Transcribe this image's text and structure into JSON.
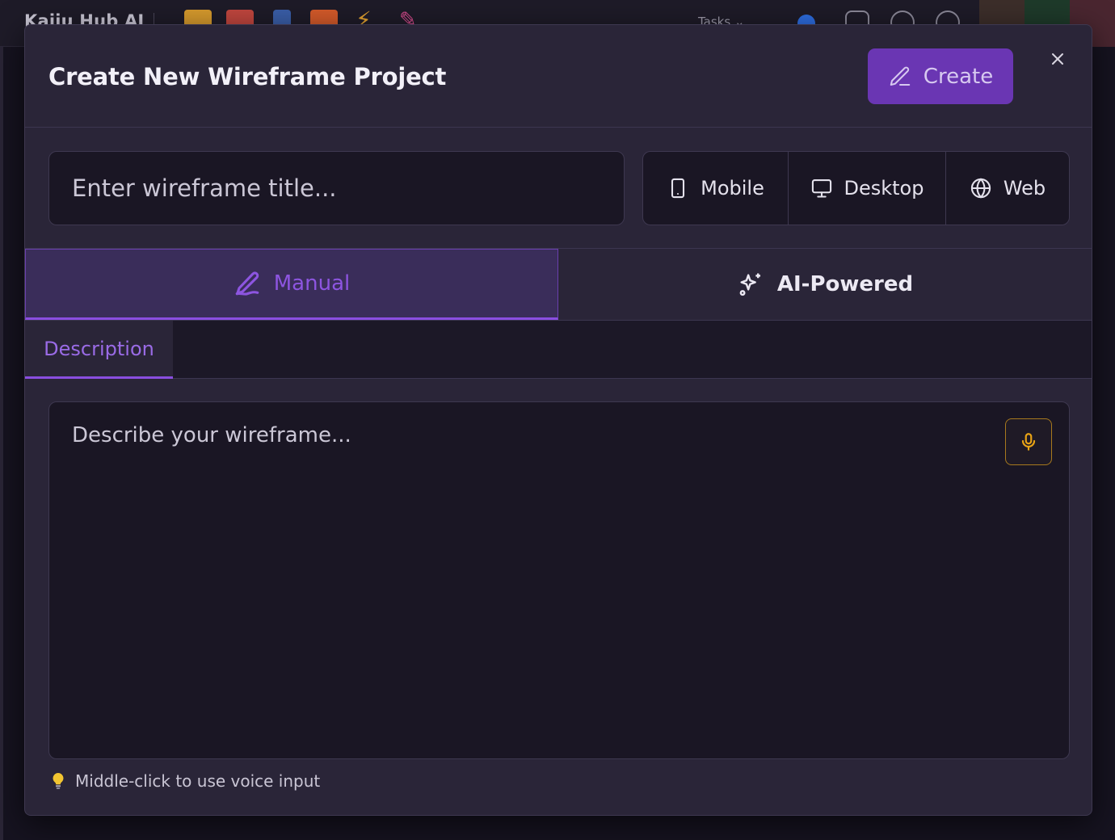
{
  "background_app": {
    "title": "Kaiju Hub AI",
    "tasks_label": "Tasks"
  },
  "modal": {
    "title": "Create New Wireframe Project",
    "create_label": "Create",
    "title_placeholder": "Enter wireframe title...",
    "devices": [
      {
        "label": "Mobile",
        "icon": "mobile-icon"
      },
      {
        "label": "Desktop",
        "icon": "desktop-icon"
      },
      {
        "label": "Web",
        "icon": "globe-icon"
      }
    ],
    "mode_tabs": [
      {
        "label": "Manual",
        "icon": "pen-icon",
        "active": true
      },
      {
        "label": "AI-Powered",
        "icon": "sparkles-icon",
        "active": false
      }
    ],
    "sub_tabs": [
      {
        "label": "Description",
        "active": true
      }
    ],
    "description_placeholder": "Describe your wireframe...",
    "hint": "Middle-click to use voice input"
  },
  "colors": {
    "accent": "#8a4ee0",
    "create_button": "#6a36b3",
    "mic_border": "#a8791e",
    "mic_icon": "#e8a316"
  }
}
